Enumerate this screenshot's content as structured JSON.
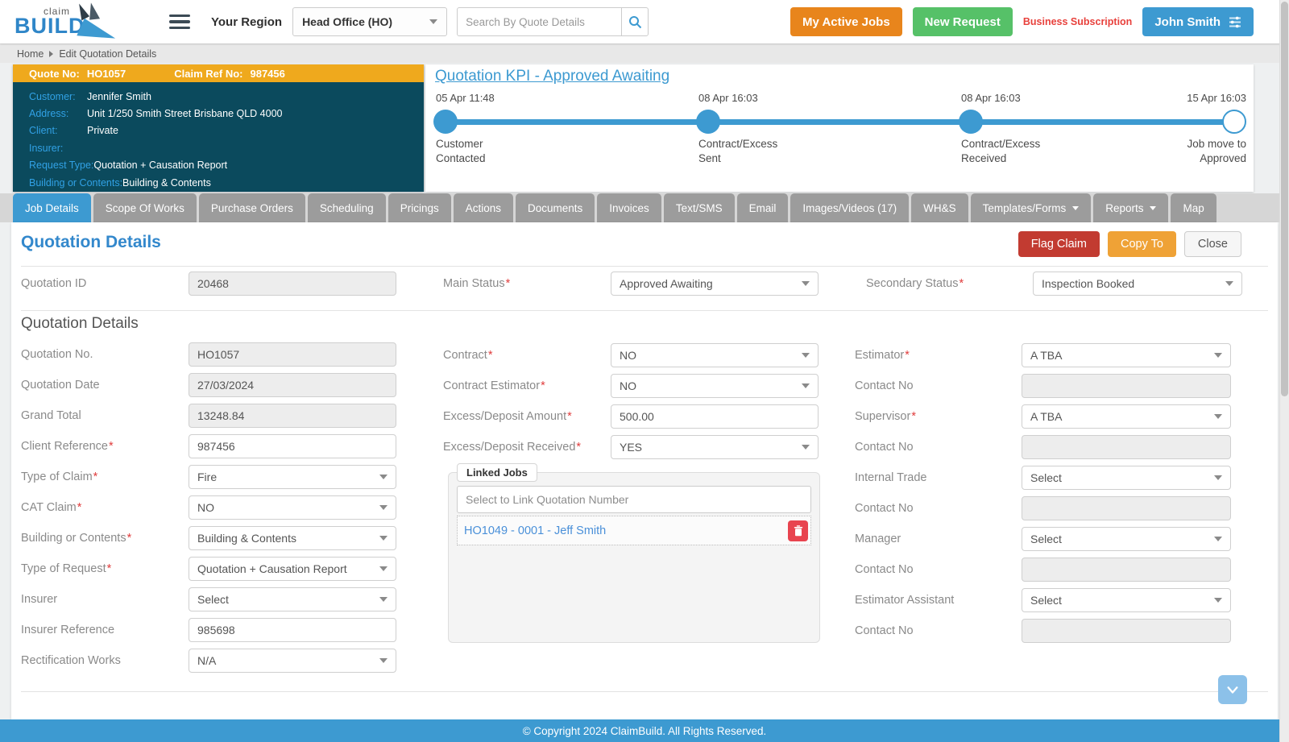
{
  "colors": {
    "accent_blue": "#3d9ad1",
    "gold_bar": "#efa91d",
    "teal_panel": "#0b4a5d",
    "teal_label_blue": "#31a1e5",
    "orange_button": "#e8851c",
    "green_button": "#56c168",
    "subscription_red": "#e8413c",
    "flag_red": "#c23b31",
    "copy_amber": "#efa236",
    "delete_red": "#e8444f",
    "tab_gray": "#9c9c9c"
  },
  "header": {
    "logo_top": "claim",
    "logo_bottom": "BUILD",
    "region_label": "Your Region",
    "region_value": "Head Office (HO)",
    "search_placeholder": "Search By Quote Details",
    "my_active_jobs_label": "My Active Jobs",
    "new_request_label": "New Request",
    "subscription_label": "Business Subscription",
    "user_name": "John Smith"
  },
  "breadcrumb": {
    "home": "Home",
    "current": "Edit Quotation Details"
  },
  "quote_panel": {
    "quote_no_label": "Quote No:",
    "quote_no": "HO1057",
    "claim_ref_label": "Claim Ref No:",
    "claim_ref": "987456",
    "rows": [
      {
        "label": "Customer:",
        "value": "Jennifer Smith"
      },
      {
        "label": "Address:",
        "value": "Unit 1/250 Smith Street Brisbane QLD 4000"
      },
      {
        "label": "Client:",
        "value": "Private"
      },
      {
        "label": "Insurer:",
        "value": ""
      },
      {
        "label": "Request Type:",
        "value": "Quotation + Causation Report"
      },
      {
        "label": "Building or Contents:",
        "value": "Building & Contents"
      }
    ]
  },
  "kpi": {
    "title": "Quotation KPI - Approved Awaiting",
    "milestones": [
      {
        "date": "05 Apr 11:48",
        "line1": "Customer",
        "line2": "Contacted",
        "filled": true
      },
      {
        "date": "08 Apr 16:03",
        "line1": "Contract/Excess",
        "line2": "Sent",
        "filled": true
      },
      {
        "date": "08 Apr 16:03",
        "line1": "Contract/Excess",
        "line2": "Received",
        "filled": true
      },
      {
        "date": "15 Apr 16:03",
        "line1": "Job move to",
        "line2": "Approved",
        "filled": false
      }
    ]
  },
  "tabs": [
    {
      "label": "Job Details",
      "active": true
    },
    {
      "label": "Scope Of Works"
    },
    {
      "label": "Purchase Orders"
    },
    {
      "label": "Scheduling"
    },
    {
      "label": "Pricings"
    },
    {
      "label": "Actions"
    },
    {
      "label": "Documents"
    },
    {
      "label": "Invoices"
    },
    {
      "label": "Text/SMS"
    },
    {
      "label": "Email"
    },
    {
      "label": "Images/Videos (17)"
    },
    {
      "label": "WH&S"
    },
    {
      "label": "Templates/Forms",
      "has_dropdown": true
    },
    {
      "label": "Reports",
      "has_dropdown": true
    },
    {
      "label": "Map"
    }
  ],
  "toolbar": {
    "page_title": "Quotation Details",
    "flag_claim_label": "Flag Claim",
    "copy_to_label": "Copy To",
    "close_label": "Close"
  },
  "form": {
    "quotation_id": {
      "label": "Quotation ID",
      "value": "20468"
    },
    "main_status": {
      "label": "Main Status",
      "value": "Approved Awaiting",
      "required": true
    },
    "secondary_status": {
      "label": "Secondary Status",
      "value": "Inspection Booked",
      "required": true
    },
    "section_title": "Quotation Details",
    "left": [
      {
        "label": "Quotation No.",
        "value": "HO1057",
        "type": "readonly"
      },
      {
        "label": "Quotation Date",
        "value": "27/03/2024",
        "type": "readonly"
      },
      {
        "label": "Grand Total",
        "value": "13248.84",
        "type": "readonly"
      },
      {
        "label": "Client Reference",
        "value": "987456",
        "type": "text",
        "required": true
      },
      {
        "label": "Type of Claim",
        "value": "Fire",
        "type": "select",
        "required": true
      },
      {
        "label": "CAT Claim",
        "value": "NO",
        "type": "select",
        "required": true
      },
      {
        "label": "Building or Contents",
        "value": "Building & Contents",
        "type": "select",
        "required": true
      },
      {
        "label": "Type of Request",
        "value": "Quotation + Causation Report",
        "type": "select",
        "required": true
      },
      {
        "label": "Insurer",
        "value": "Select",
        "type": "select"
      },
      {
        "label": "Insurer Reference",
        "value": "985698",
        "type": "text"
      },
      {
        "label": "Rectification Works",
        "value": "N/A",
        "type": "select"
      }
    ],
    "middle": [
      {
        "label": "Contract",
        "value": "NO",
        "type": "select",
        "required": true
      },
      {
        "label": "Contract Estimator",
        "value": "NO",
        "type": "select",
        "required": true
      },
      {
        "label": "Excess/Deposit Amount",
        "value": "500.00",
        "type": "text",
        "required": true
      },
      {
        "label": "Excess/Deposit Received",
        "value": "YES",
        "type": "select",
        "required": true
      }
    ],
    "linked_jobs": {
      "legend": "Linked Jobs",
      "placeholder": "Select to Link Quotation Number",
      "items": [
        {
          "label": "HO1049 - 0001 - Jeff Smith"
        }
      ]
    },
    "right": [
      {
        "label": "Estimator",
        "value": "A TBA",
        "type": "select",
        "required": true
      },
      {
        "label": "Contact No",
        "value": "",
        "type": "readonly"
      },
      {
        "label": "Supervisor",
        "value": "A TBA",
        "type": "select",
        "required": true
      },
      {
        "label": "Contact No",
        "value": "",
        "type": "readonly"
      },
      {
        "label": "Internal Trade",
        "value": "Select",
        "type": "select"
      },
      {
        "label": "Contact No",
        "value": "",
        "type": "readonly"
      },
      {
        "label": "Manager",
        "value": "Select",
        "type": "select"
      },
      {
        "label": "Contact No",
        "value": "",
        "type": "readonly"
      },
      {
        "label": "Estimator Assistant",
        "value": "Select",
        "type": "select"
      },
      {
        "label": "Contact No",
        "value": "",
        "type": "readonly"
      }
    ]
  },
  "footer": {
    "copyright": "© Copyright 2024 ClaimBuild. All Rights Reserved."
  }
}
